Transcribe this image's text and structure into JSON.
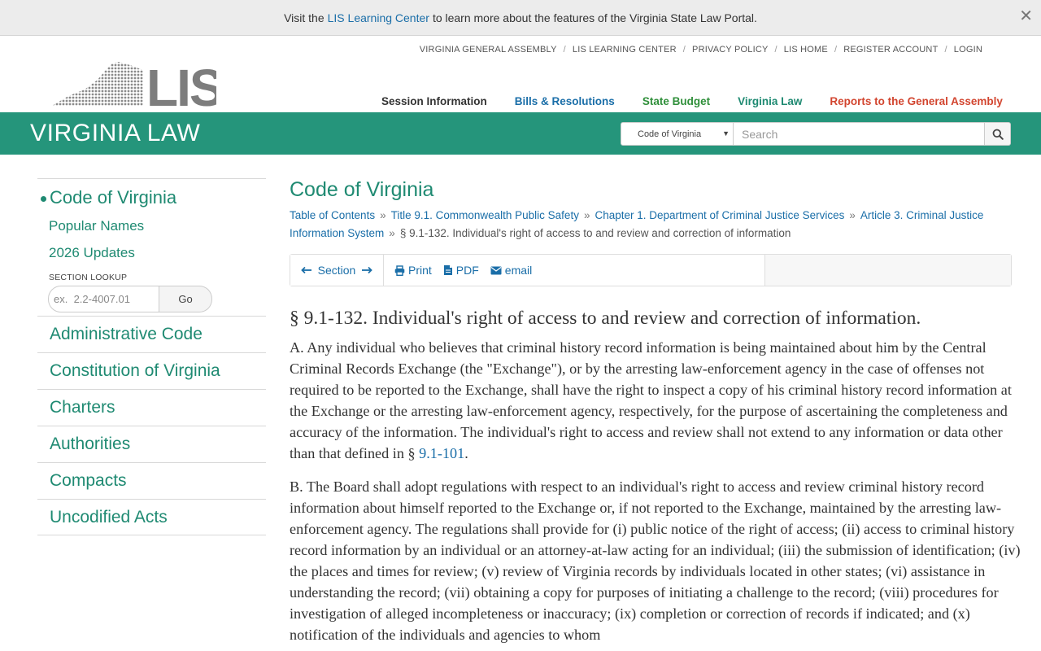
{
  "banner": {
    "prefix": "Visit the",
    "link": "LIS Learning Center",
    "suffix": "to learn more about the features of the Virginia State Law Portal.",
    "close": "✕"
  },
  "utility_nav": [
    "VIRGINIA GENERAL ASSEMBLY",
    "LIS LEARNING CENTER",
    "PRIVACY POLICY",
    "LIS HOME",
    "REGISTER ACCOUNT",
    "LOGIN"
  ],
  "utility_separator": "/",
  "logo": {
    "text": "LIS"
  },
  "main_nav": [
    {
      "label": "Session Information",
      "color": "#333333"
    },
    {
      "label": "Bills & Resolutions",
      "color": "#1a6ea8"
    },
    {
      "label": "State Budget",
      "color": "#2f8f3a"
    },
    {
      "label": "Virginia Law",
      "color": "#1f8a72"
    },
    {
      "label": "Reports to the General Assembly",
      "color": "#d2452f"
    }
  ],
  "greenbar": {
    "title": "VIRGINIA LAW",
    "scope_select": "Code of Virginia",
    "search_placeholder": "Search",
    "search_icon": "search-icon"
  },
  "sidebar": {
    "active": "Code of Virginia",
    "subitems": [
      "Popular Names",
      "2026 Updates"
    ],
    "lookup_label": "SECTION LOOKUP",
    "lookup_placeholder": "ex.  2.2-4007.01",
    "lookup_button": "Go",
    "items": [
      "Administrative Code",
      "Constitution of Virginia",
      "Charters",
      "Authorities",
      "Compacts",
      "Uncodified Acts"
    ]
  },
  "main": {
    "title": "Code of Virginia",
    "breadcrumb_separator": "»",
    "breadcrumbs": [
      "Table of Contents",
      "Title 9.1. Commonwealth Public Safety",
      "Chapter 1. Department of Criminal Justice Services",
      "Article 3. Criminal Justice Information System"
    ],
    "breadcrumb_current": "§ 9.1-132. Individual's right of access to and review and correction of information",
    "toolbar": {
      "section_label": "Section",
      "print": "Print",
      "pdf": "PDF",
      "email": "email"
    },
    "heading": "§ 9.1-132. Individual's right of access to and review and correction of information.",
    "para_a_text": "A. Any individual who believes that criminal history record information is being maintained about him by the Central Criminal Records Exchange (the \"Exchange\"), or by the arresting law-enforcement agency in the case of offenses not required to be reported to the Exchange, shall have the right to inspect a copy of his criminal history record information at the Exchange or the arresting law-enforcement agency, respectively, for the purpose of ascertaining the completeness and accuracy of the information. The individual's right to access and review shall not extend to any information or data other than that defined in §",
    "para_a_link": "9.1-101",
    "para_a_end": ".",
    "para_b_text": "B. The Board shall adopt regulations with respect to an individual's right to access and review criminal history record information about himself reported to the Exchange or, if not reported to the Exchange, maintained by the arresting law-enforcement agency. The regulations shall provide for (i) public notice of the right of access; (ii) access to criminal history record information by an individual or an attorney-at-law acting for an individual; (iii) the submission of identification; (iv) the places and times for review; (v) review of Virginia records by individuals located in other states; (vi) assistance in understanding the record; (vii) obtaining a copy for purposes of initiating a challenge to the record; (viii) procedures for investigation of alleged incompleteness or inaccuracy; (ix) completion or correction of records if indicated; and (x) notification of the individuals and agencies to whom"
  },
  "colors": {
    "green": "#25957b",
    "link_blue": "#1a6ea8",
    "teal_text": "#1f8a72"
  }
}
